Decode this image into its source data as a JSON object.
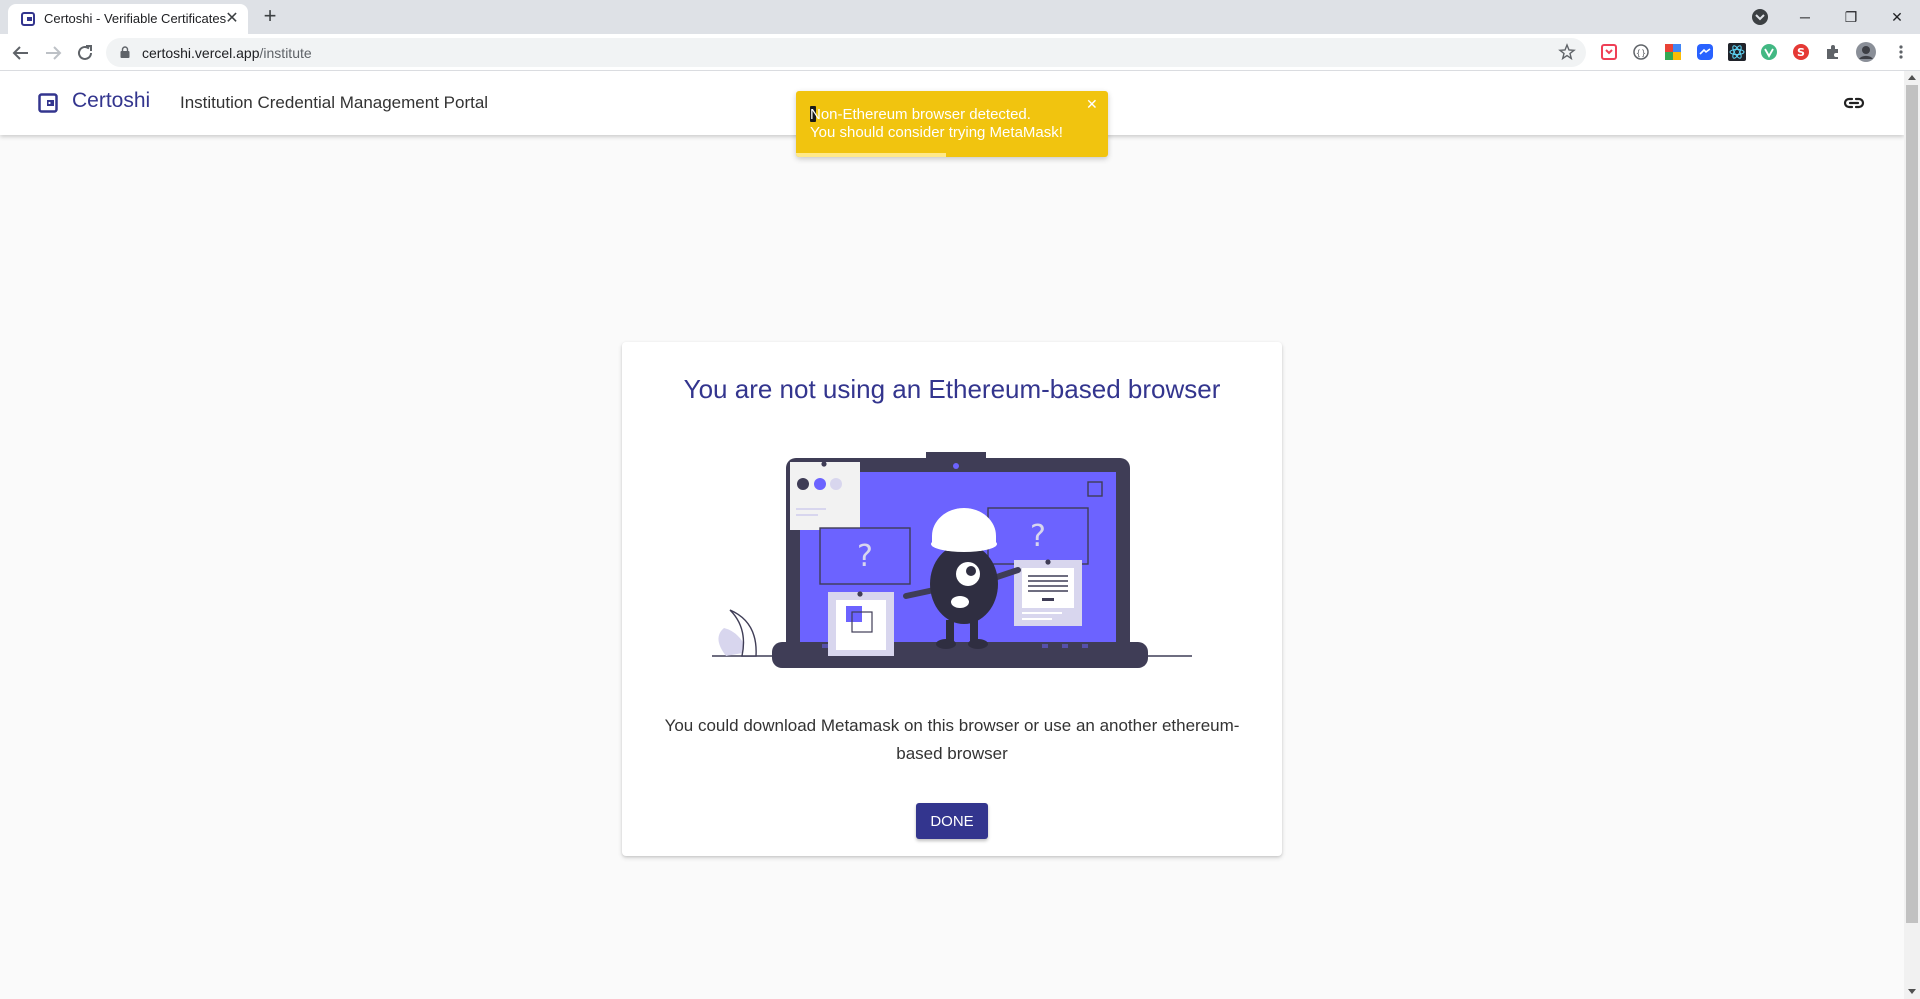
{
  "browser": {
    "tab": {
      "title": "Certoshi - Verifiable Certificates",
      "close": "✕"
    },
    "new_tab": "+",
    "window_controls": {
      "minimize": "─",
      "restore": "❐",
      "close": "✕"
    },
    "address": {
      "host": "certoshi.vercel.app",
      "path": "/institute"
    },
    "extensions": [
      "pocket-icon",
      "dev-icon",
      "colorzilla-icon",
      "messenger-icon",
      "react-icon",
      "vue-icon",
      "s-extension-icon",
      "puzzle-icon"
    ]
  },
  "appbar": {
    "brand": "Certoshi",
    "subtitle": "Institution Credential Management Portal"
  },
  "toast": {
    "line1": "Non-Ethereum browser detected.",
    "line2": "You should consider trying MetaMask!",
    "close": "✕",
    "color": "#f1c40f",
    "progress": 0.48
  },
  "card": {
    "title": "You are not using an Ethereum-based browser",
    "body": "You could download Metamask on this browser or use an another ethereum-based browser",
    "done_label": "DONE"
  },
  "colors": {
    "primary": "#33358e",
    "illustration": "#6c63ff",
    "dark": "#3f3d56"
  }
}
